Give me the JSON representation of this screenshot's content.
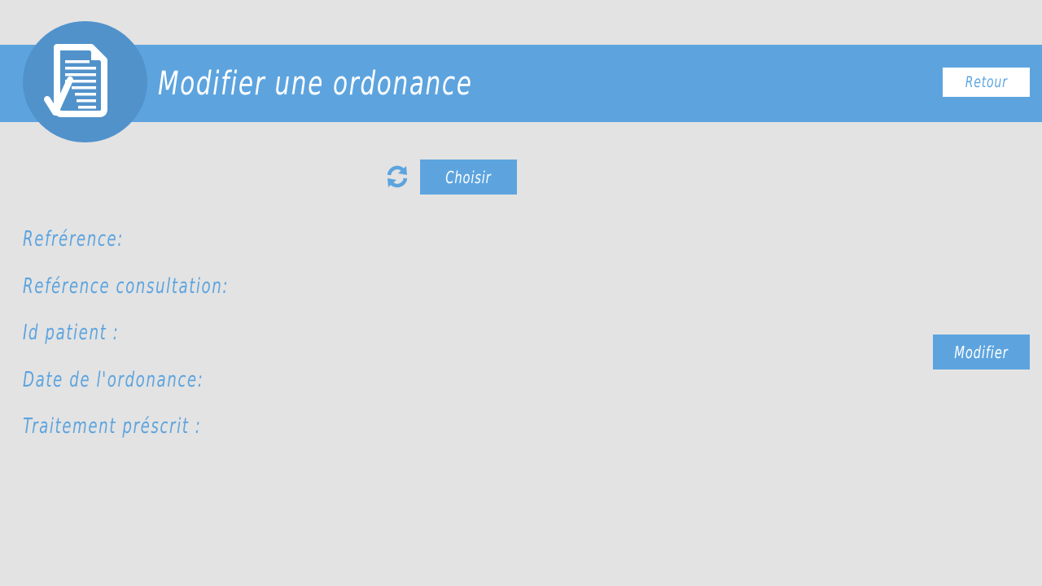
{
  "header": {
    "title": "Modifier une ordonance",
    "back_label": "Retour",
    "logo_icon": "prescription-check-icon"
  },
  "chooser": {
    "refresh_icon": "refresh-icon",
    "choose_label": "Choisir"
  },
  "form": {
    "fields": [
      {
        "label": "Refrérence:"
      },
      {
        "label": "Reférence consultation:"
      },
      {
        "label": "Id patient :"
      },
      {
        "label": "Date de l'ordonance:"
      },
      {
        "label": "Traitement préscrit :"
      }
    ],
    "submit_label": "Modifier"
  },
  "colors": {
    "background": "#e3e3e3",
    "accent": "#5da4df",
    "logo_circle": "#5192cb",
    "button_text_light": "#ffffff"
  }
}
